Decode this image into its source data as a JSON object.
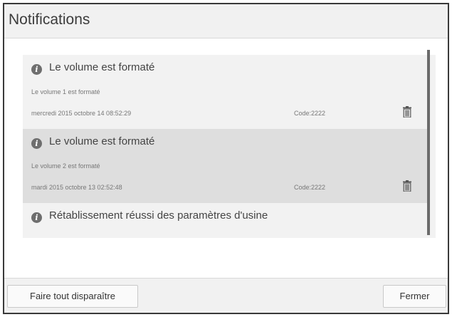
{
  "dialog": {
    "title": "Notifications"
  },
  "notifications": [
    {
      "title": "Le volume est formaté",
      "description": "Le volume 1 est formaté",
      "date": "mercredi 2015 octobre 14 08:52:29",
      "code": "Code:2222",
      "icon": "info-icon",
      "selected": false
    },
    {
      "title": "Le volume est formaté",
      "description": "Le volume 2 est formaté",
      "date": "mardi 2015 octobre 13 02:52:48",
      "code": "Code:2222",
      "icon": "info-icon",
      "selected": true
    },
    {
      "title": "Rétablissement réussi des paramètres d'usine",
      "icon": "info-icon",
      "selected": false
    }
  ],
  "footer": {
    "clear_all_label": "Faire tout disparaître",
    "close_label": "Fermer"
  },
  "colors": {
    "selected_row": "#dedede",
    "row": "#f2f2f2",
    "chrome": "#f1f1f1"
  }
}
